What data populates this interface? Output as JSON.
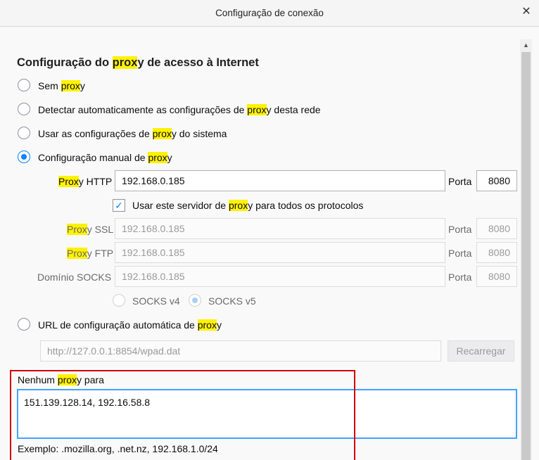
{
  "window": {
    "title": "Configuração de conexão",
    "close_glyph": "✕"
  },
  "section": {
    "heading": [
      "Configuração do ",
      "prox",
      "y de acesso à Internet"
    ]
  },
  "options": {
    "no_proxy": [
      "Sem ",
      "prox",
      "y"
    ],
    "auto_detect": [
      "Detectar automaticamente as configurações de ",
      "prox",
      "y desta rede"
    ],
    "system": [
      "Usar as configurações de ",
      "prox",
      "y do sistema"
    ],
    "manual": [
      "Configuração manual de ",
      "prox",
      "y"
    ],
    "auto_url": [
      "URL de configuração automática de ",
      "prox",
      "y"
    ],
    "selected": "manual"
  },
  "http": {
    "label": [
      "Prox",
      "y HTTP"
    ],
    "value": "192.168.0.185",
    "port_label": "Porta",
    "port": "8080"
  },
  "share": {
    "label": [
      "Usar este servidor de ",
      "prox",
      "y para todos os protocolos"
    ],
    "checked": true
  },
  "ssl": {
    "label": [
      "Prox",
      "y SSL"
    ],
    "value": "192.168.0.185",
    "port_label": "Porta",
    "port": "8080"
  },
  "ftp": {
    "label": [
      "Prox",
      "y FTP"
    ],
    "value": "192.168.0.185",
    "port_label": "Porta",
    "port": "8080"
  },
  "socks": {
    "label": "Domínio SOCKS",
    "value": "192.168.0.185",
    "port_label": "Porta",
    "port": "8080",
    "v4": "SOCKS v4",
    "v5": "SOCKS v5",
    "selected": "v5"
  },
  "autoconfig": {
    "placeholder": "http://127.0.0.1:8854/wpad.dat",
    "reload": "Recarregar"
  },
  "no_proxy_for": {
    "label": [
      "Nenhum ",
      "prox",
      "y para"
    ],
    "value": "151.139.128.14, 192.16.58.8",
    "example": "Exemplo: .mozilla.org, .net.nz, 192.168.1.0/24"
  },
  "colors": {
    "accent": "#0a84ff",
    "highlight": "#fff200",
    "annotation": "#d20000"
  }
}
